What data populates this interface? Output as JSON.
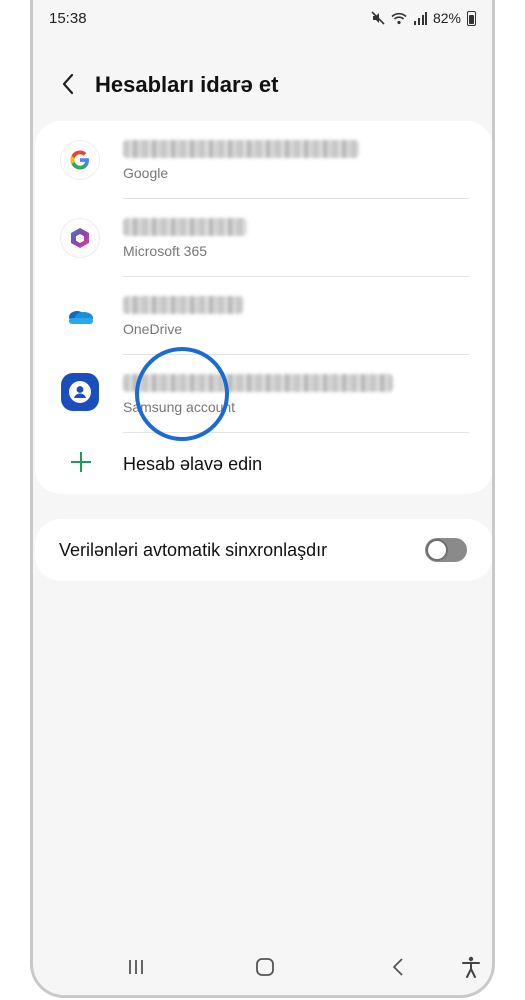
{
  "status_bar": {
    "time": "15:38",
    "battery": "82%"
  },
  "header": {
    "title": "Hesabları idarə et"
  },
  "accounts": [
    {
      "type_label": "Google",
      "icon": "google-icon"
    },
    {
      "type_label": "Microsoft 365",
      "icon": "microsoft365-icon"
    },
    {
      "type_label": "OneDrive",
      "icon": "onedrive-icon"
    },
    {
      "type_label": "Samsung account",
      "icon": "samsung-account-icon"
    }
  ],
  "add_account": {
    "label": "Hesab əlavə edin",
    "icon": "plus-icon"
  },
  "sync": {
    "label": "Verilənləri avtomatik sinxronlaşdır",
    "enabled": false
  },
  "colors": {
    "accent_green": "#1a9c5a",
    "highlight_blue": "#1c6ad4",
    "samsung_blue": "#1b4dbd"
  }
}
